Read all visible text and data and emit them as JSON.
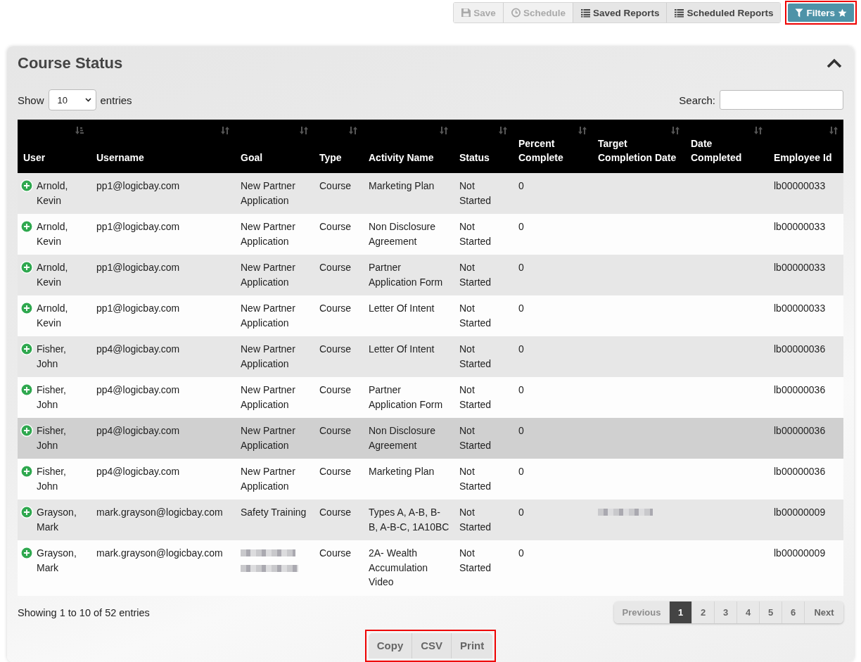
{
  "toolbar": {
    "buttons": [
      {
        "label": "Save",
        "kind": "save",
        "disabled": true
      },
      {
        "label": "Schedule",
        "kind": "schedule",
        "disabled": true
      },
      {
        "label": "Saved Reports",
        "kind": "list",
        "disabled": false
      },
      {
        "label": "Scheduled Reports",
        "kind": "list",
        "disabled": false
      }
    ],
    "filters": {
      "label": "Filters",
      "highlighted": true
    }
  },
  "panel": {
    "title": "Course Status",
    "expanded": true,
    "length_menu": {
      "before": "Show",
      "value": "10",
      "after": "entries"
    },
    "search": {
      "label": "Search:"
    },
    "table": {
      "columns": [
        {
          "label": "User",
          "sorted": true
        },
        {
          "label": "Username",
          "sorted": false
        },
        {
          "label": "Goal",
          "sorted": false
        },
        {
          "label": "Type",
          "sorted": false
        },
        {
          "label": "Activity Name",
          "sorted": false
        },
        {
          "label": "Status",
          "sorted": false
        },
        {
          "label": "Percent Complete",
          "sorted": false
        },
        {
          "label": "Target Completion Date",
          "sorted": false
        },
        {
          "label": "Date Completed",
          "sorted": false
        },
        {
          "label": "Employee Id",
          "sorted": false
        }
      ],
      "rows": [
        {
          "hovered": false,
          "cells": [
            "Arnold, Kevin",
            "pp1@logicbay.com",
            "New Partner Application",
            "Course",
            "Marketing Plan",
            "Not Started",
            "0",
            "",
            "",
            "lb00000033"
          ]
        },
        {
          "hovered": false,
          "cells": [
            "Arnold, Kevin",
            "pp1@logicbay.com",
            "New Partner Application",
            "Course",
            "Non Disclosure Agreement",
            "Not Started",
            "0",
            "",
            "",
            "lb00000033"
          ]
        },
        {
          "hovered": false,
          "cells": [
            "Arnold, Kevin",
            "pp1@logicbay.com",
            "New Partner Application",
            "Course",
            "Partner Application Form",
            "Not Started",
            "0",
            "",
            "",
            "lb00000033"
          ]
        },
        {
          "hovered": false,
          "cells": [
            "Arnold, Kevin",
            "pp1@logicbay.com",
            "New Partner Application",
            "Course",
            "Letter Of Intent",
            "Not Started",
            "0",
            "",
            "",
            "lb00000033"
          ]
        },
        {
          "hovered": false,
          "cells": [
            "Fisher, John",
            "pp4@logicbay.com",
            "New Partner Application",
            "Course",
            "Letter Of Intent",
            "Not Started",
            "0",
            "",
            "",
            "lb00000036"
          ]
        },
        {
          "hovered": false,
          "cells": [
            "Fisher, John",
            "pp4@logicbay.com",
            "New Partner Application",
            "Course",
            "Partner Application Form",
            "Not Started",
            "0",
            "",
            "",
            "lb00000036"
          ]
        },
        {
          "hovered": true,
          "cells": [
            "Fisher, John",
            "pp4@logicbay.com",
            "New Partner Application",
            "Course",
            "Non Disclosure Agreement",
            "Not Started",
            "0",
            "",
            "",
            "lb00000036"
          ]
        },
        {
          "hovered": false,
          "cells": [
            "Fisher, John",
            "pp4@logicbay.com",
            "New Partner Application",
            "Course",
            "Marketing Plan",
            "Not Started",
            "0",
            "",
            "",
            "lb00000036"
          ]
        },
        {
          "hovered": false,
          "cells": [
            "Grayson, Mark",
            "mark.grayson@logicbay.com",
            "Safety Training",
            "Course",
            "Types A, A-B, B-B, A-B-C, 1A10BC",
            "Not Started",
            "0",
            {
              "kind": "blurred_line"
            },
            "",
            "lb00000009"
          ]
        },
        {
          "hovered": false,
          "cells": [
            "Grayson, Mark",
            "mark.grayson@logicbay.com",
            {
              "kind": "blurred_block"
            },
            "Course",
            "2A- Wealth Accumulation Video",
            "Not Started",
            "0",
            "",
            "",
            "lb00000009"
          ]
        }
      ]
    },
    "info": "Showing 1 to 10 of 52 entries",
    "pagination": [
      {
        "label": "Previous",
        "kind": "prev",
        "disabled": true,
        "selected": false
      },
      {
        "label": "1",
        "kind": "page",
        "disabled": false,
        "selected": true
      },
      {
        "label": "2",
        "kind": "page",
        "disabled": false,
        "selected": false
      },
      {
        "label": "3",
        "kind": "page",
        "disabled": false,
        "selected": false
      },
      {
        "label": "4",
        "kind": "page",
        "disabled": false,
        "selected": false
      },
      {
        "label": "5",
        "kind": "page",
        "disabled": false,
        "selected": false
      },
      {
        "label": "6",
        "kind": "page",
        "disabled": false,
        "selected": false
      },
      {
        "label": "Next",
        "kind": "next",
        "disabled": false,
        "selected": false
      }
    ],
    "export": {
      "highlighted": true,
      "buttons": [
        "Copy",
        "CSV",
        "Print"
      ]
    }
  }
}
